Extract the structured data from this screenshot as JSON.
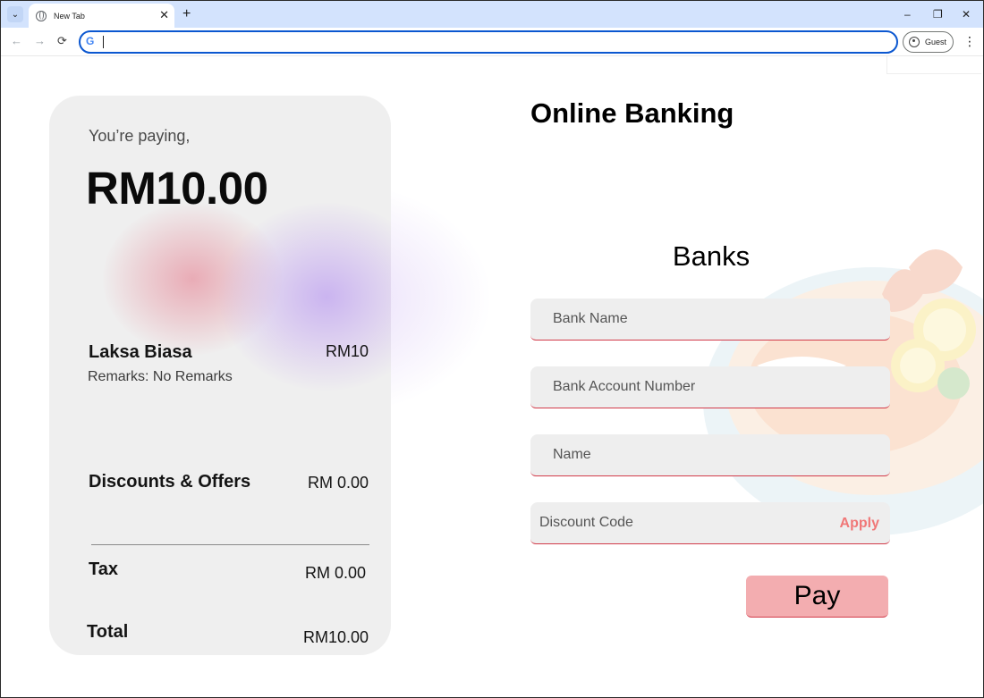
{
  "browser": {
    "tab_title": "New Tab",
    "new_tab_label": "+",
    "profile_label": "Guest",
    "omnibox_value": ""
  },
  "summary": {
    "paying_label": "You’re paying,",
    "amount": "RM10.00",
    "item": {
      "name": "Laksa Biasa",
      "price": "RM10",
      "remarks": "Remarks: No Remarks"
    },
    "discounts_label": "Discounts & Offers",
    "discounts_value": "RM 0.00",
    "tax_label": "Tax",
    "tax_value": "RM 0.00",
    "total_label": "Total",
    "total_value": "RM10.00"
  },
  "form": {
    "title": "Online Banking",
    "banks_heading": "Banks",
    "fields": {
      "bank_name_placeholder": "Bank Name",
      "account_number_placeholder": "Bank Account Number",
      "name_placeholder": "Name",
      "discount_placeholder": "Discount Code"
    },
    "apply_label": "Apply",
    "pay_label": "Pay"
  },
  "colors": {
    "accent_red": "#d23b4a",
    "apply_text": "#f07878",
    "pay_button": "#f3adb0",
    "card_bg": "#efefef",
    "field_bg": "#eeeeee"
  }
}
